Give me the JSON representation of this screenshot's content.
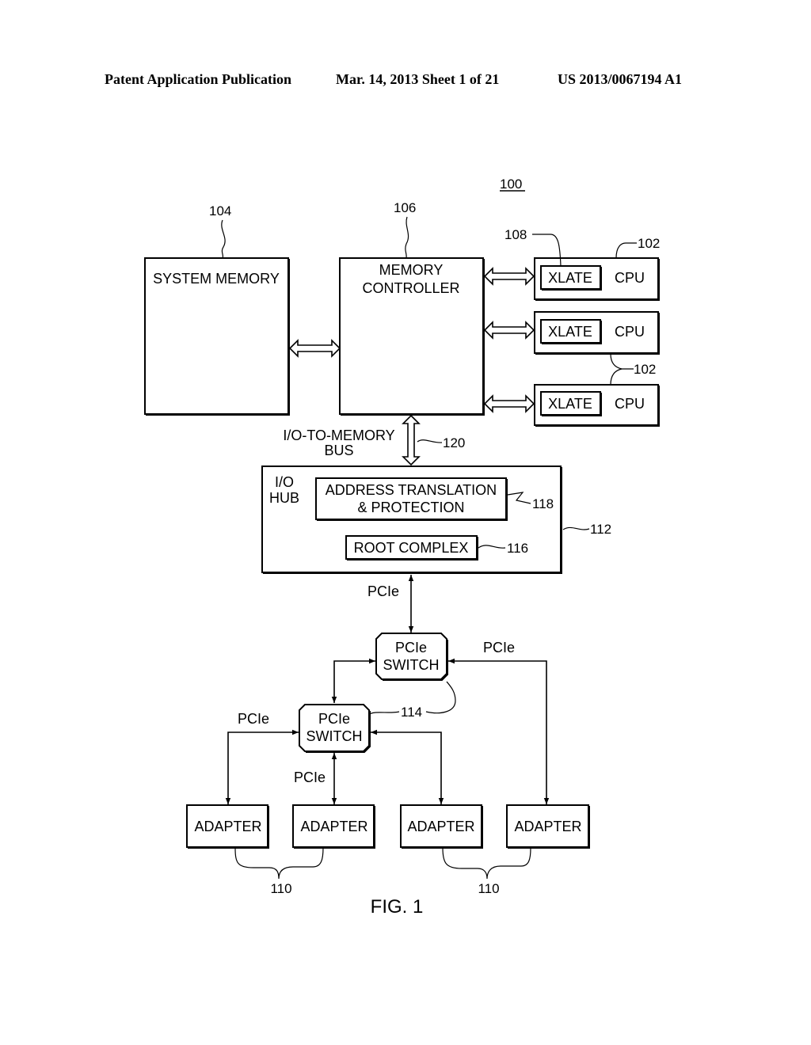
{
  "header": {
    "publication": "Patent Application Publication",
    "date_sheet": "Mar. 14, 2013  Sheet 1 of 21",
    "number": "US 2013/0067194 A1"
  },
  "figure": {
    "system_ref": "100",
    "caption": "FIG. 1",
    "system_memory": {
      "label": "SYSTEM MEMORY",
      "ref": "104"
    },
    "memory_controller": {
      "label_line1": "MEMORY",
      "label_line2": "CONTROLLER",
      "ref": "106"
    },
    "cpus": [
      {
        "xlate": "XLATE",
        "cpu": "CPU"
      },
      {
        "xlate": "XLATE",
        "cpu": "CPU"
      },
      {
        "xlate": "XLATE",
        "cpu": "CPU"
      }
    ],
    "cpu_ref_top": "102",
    "cpu_ref_mid": "102",
    "xlate_ref": "108",
    "bus": {
      "label_line1": "I/O-TO-MEMORY",
      "label_line2": "BUS",
      "ref": "120"
    },
    "io_hub": {
      "label_line1": "I/O",
      "label_line2": "HUB",
      "ref": "112",
      "addr_trans": {
        "line1": "ADDRESS TRANSLATION",
        "line2": "& PROTECTION",
        "ref": "118"
      },
      "root_complex": {
        "label": "ROOT COMPLEX",
        "ref": "116"
      }
    },
    "switches": [
      {
        "line1": "PCIe",
        "line2": "SWITCH"
      },
      {
        "line1": "PCIe",
        "line2": "SWITCH"
      }
    ],
    "switch_ref": "114",
    "pcie_labels": [
      "PCIe",
      "PCIe",
      "PCIe",
      "PCIe"
    ],
    "adapters": [
      "ADAPTER",
      "ADAPTER",
      "ADAPTER",
      "ADAPTER"
    ],
    "adapter_refs": [
      "110",
      "110"
    ]
  }
}
